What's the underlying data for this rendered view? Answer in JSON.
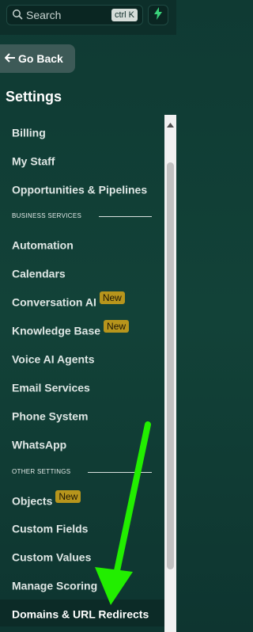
{
  "search": {
    "placeholder": "Search",
    "shortcut": "ctrl K"
  },
  "nav": {
    "back_label": "Go Back",
    "title": "Settings"
  },
  "items_top": [
    {
      "label": "Billing"
    },
    {
      "label": "My Staff"
    },
    {
      "label": "Opportunities & Pipelines"
    }
  ],
  "sections": {
    "business": "BUSINESS SERVICES",
    "other": "OTHER SETTINGS"
  },
  "items_business": [
    {
      "label": "Automation",
      "badge": ""
    },
    {
      "label": "Calendars",
      "badge": ""
    },
    {
      "label": "Conversation AI",
      "badge": "New"
    },
    {
      "label": "Knowledge Base",
      "badge": "New"
    },
    {
      "label": "Voice AI Agents",
      "badge": ""
    },
    {
      "label": "Email Services",
      "badge": ""
    },
    {
      "label": "Phone System",
      "badge": ""
    },
    {
      "label": "WhatsApp",
      "badge": ""
    }
  ],
  "items_other": [
    {
      "label": "Objects",
      "badge": "New"
    },
    {
      "label": "Custom Fields",
      "badge": ""
    },
    {
      "label": "Custom Values",
      "badge": ""
    },
    {
      "label": "Manage Scoring",
      "badge": ""
    },
    {
      "label": "Domains & URL Redirects",
      "badge": ""
    }
  ],
  "colors": {
    "background": "#124238",
    "badge": "#b7951c",
    "annotation_arrow": "#22ee00",
    "bolt": "#3ad27a"
  },
  "icons": [
    "search-icon",
    "lightning-icon",
    "arrow-left-icon",
    "scroll-up-icon"
  ]
}
